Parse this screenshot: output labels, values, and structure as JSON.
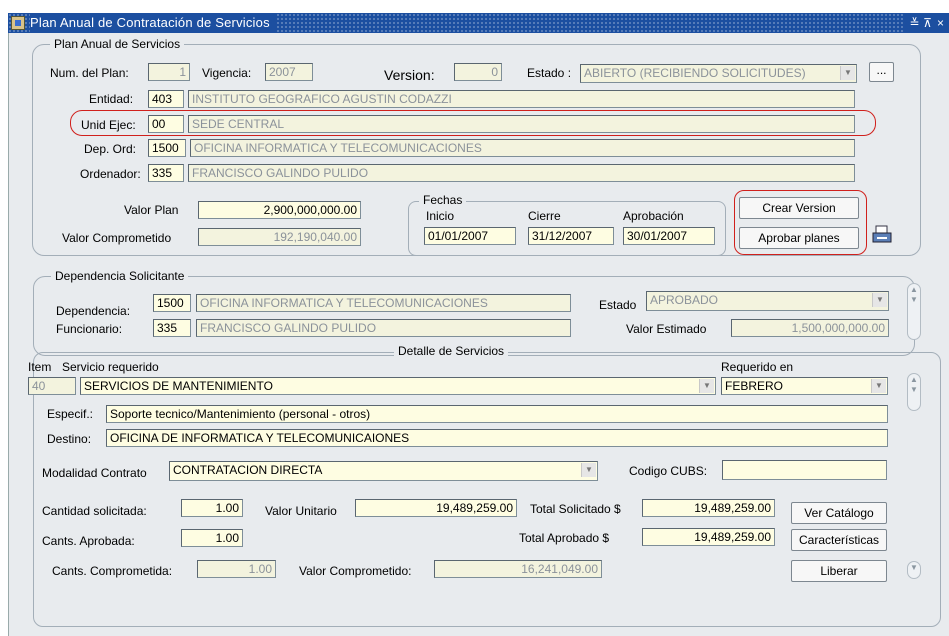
{
  "window": {
    "title": "Plan Anual de Contratación de Servicios",
    "ctrl_min": "≚",
    "ctrl_max": "⊼",
    "ctrl_close": "×"
  },
  "plan": {
    "legend": "Plan Anual de Servicios",
    "num_label": "Num. del Plan:",
    "num_value": "1",
    "vigencia_label": "Vigencia:",
    "vigencia_value": "2007",
    "version_label": "Version:",
    "version_value": "0",
    "estado_label": "Estado :",
    "estado_value": "ABIERTO (RECIBIENDO SOLICITUDES)",
    "more_label": "...",
    "entidad_label": "Entidad:",
    "entidad_code": "403",
    "entidad_name": "INSTITUTO GEOGRAFICO AGUSTIN CODAZZI",
    "unid_label": "Unid Ejec:",
    "unid_code": "00",
    "unid_name": "SEDE CENTRAL",
    "dep_label": "Dep. Ord:",
    "dep_code": "1500",
    "dep_name": "OFICINA  INFORMATICA Y TELECOMUNICACIONES",
    "ordenador_label": "Ordenador:",
    "ordenador_code": "335",
    "ordenador_name": "FRANCISCO GALINDO PULIDO",
    "valor_plan_label": "Valor Plan",
    "valor_plan_value": "2,900,000,000.00",
    "valor_comp_label": "Valor Comprometido",
    "valor_comp_value": "192,190,040.00",
    "fechas_legend": "Fechas",
    "inicio_label": "Inicio",
    "inicio_value": "01/01/2007",
    "cierre_label": "Cierre",
    "cierre_value": "31/12/2007",
    "aprob_label": "Aprobación",
    "aprob_value": "30/01/2007",
    "crear_version": "Crear Version",
    "aprobar_planes": "Aprobar planes"
  },
  "dependencia": {
    "legend": "Dependencia Solicitante",
    "dep_label": "Dependencia:",
    "dep_code": "1500",
    "dep_name": "OFICINA  INFORMATICA Y TELECOMUNICACIONES",
    "func_label": "Funcionario:",
    "func_code": "335",
    "func_name": "FRANCISCO GALINDO PULIDO",
    "estado_label": "Estado",
    "estado_value": "APROBADO",
    "valor_est_label": "Valor Estimado",
    "valor_est_value": "1,500,000,000.00"
  },
  "detalle": {
    "legend": "Detalle de Servicios",
    "item_label": "Item",
    "item_value": "40",
    "servicio_label": "Servicio requerido",
    "servicio_value": "SERVICIOS DE MANTENIMIENTO",
    "requerido_label": "Requerido en",
    "requerido_value": "FEBRERO",
    "especif_label": "Especif.:",
    "especif_value": "Soporte tecnico/Mantenimiento (personal - otros)",
    "destino_label": "Destino:",
    "destino_value": "OFICINA DE INFORMATICA Y TELECOMUNICAIONES",
    "modalidad_label": "Modalidad Contrato",
    "modalidad_value": "CONTRATACION DIRECTA",
    "cubs_label": "Codigo CUBS:",
    "cubs_value": "",
    "cant_sol_label": "Cantidad solicitada:",
    "cant_sol_value": "1.00",
    "valor_unit_label": "Valor Unitario",
    "valor_unit_value": "19,489,259.00",
    "total_sol_label": "Total Solicitado $",
    "total_sol_value": "19,489,259.00",
    "cant_apr_label": "Cants. Aprobada:",
    "cant_apr_value": "1.00",
    "total_apr_label": "Total Aprobado $",
    "total_apr_value": "19,489,259.00",
    "cant_comp_label": "Cants. Comprometida:",
    "cant_comp_value": "1.00",
    "valor_comp_label": "Valor Comprometido:",
    "valor_comp_value": "16,241,049.00",
    "ver_catalogo": "Ver Catálogo",
    "caracteristicas": "Características",
    "liberar": "Liberar"
  }
}
